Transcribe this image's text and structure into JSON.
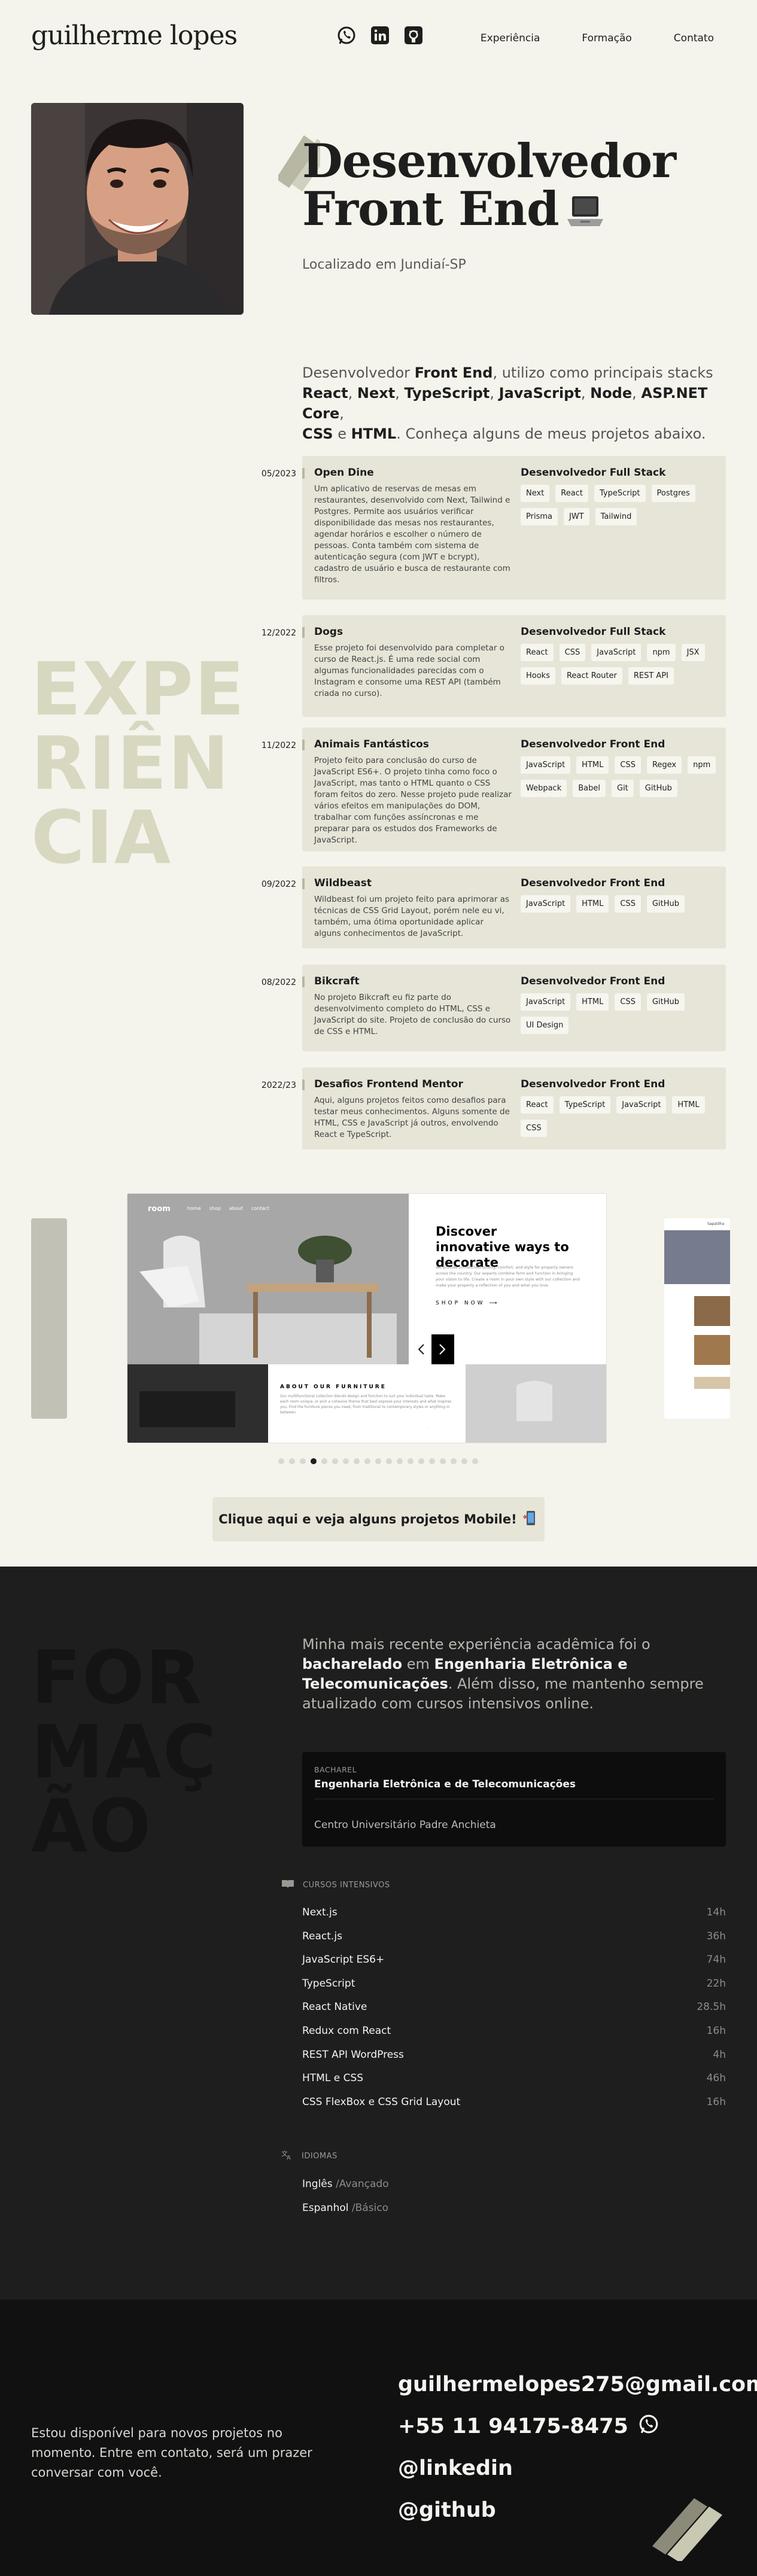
{
  "header": {
    "logo": "guilherme lopes",
    "nav": [
      "Experiência",
      "Formação",
      "Contato"
    ]
  },
  "hero": {
    "title_line1": "Desenvolvedor",
    "title_line2": "Front End",
    "location": "Localizado em Jundiaí-SP",
    "intro_pre": "Desenvolvedor ",
    "intro_b1": "Front End",
    "intro_mid": ", utilizo como principais stacks ",
    "intro_b2": "React",
    "intro_b3": "Next",
    "intro_b4": "TypeScript",
    "intro_b5": "JavaScript",
    "intro_b6": "Node",
    "intro_b7": "ASP.NET Core",
    "intro_b8": "CSS",
    "intro_e": " e ",
    "intro_b9": "HTML",
    "intro_post": ". Conheça alguns de meus projetos abaixo.",
    "comma": ", "
  },
  "experience": {
    "big_word": [
      "EXPE",
      "RIÊN",
      "CIA"
    ],
    "items": [
      {
        "date": "05/2023",
        "name": "Open Dine",
        "desc": "Um aplicativo de reservas de mesas em restaurantes, desenvolvido com Next, Tailwind e Postgres. Permite aos usuários verificar disponibilidade das mesas nos restaurantes, agendar horários e escolher o número de pessoas. Conta também com sistema de autenticação segura (com JWT e bcrypt), cadastro de usuário e busca de restaurante com filtros.",
        "role": "Desenvolvedor Full Stack",
        "tags": [
          "Next",
          "React",
          "TypeScript",
          "Postgres",
          "Prisma",
          "JWT",
          "Tailwind"
        ]
      },
      {
        "date": "12/2022",
        "name": "Dogs",
        "desc": "Esse projeto foi desenvolvido para completar o curso de React.js. É uma rede social com algumas funcionalidades parecidas com o Instagram e consome uma REST API (também criada no curso).",
        "role": "Desenvolvedor Full Stack",
        "tags": [
          "React",
          "CSS",
          "JavaScript",
          "npm",
          "JSX",
          "Hooks",
          "React Router",
          "REST API"
        ]
      },
      {
        "date": "11/2022",
        "name": "Animais Fantásticos",
        "desc": "Projeto feito para conclusão do curso de JavaScript ES6+. O projeto tinha como foco o JavaScript, mas tanto o HTML quanto o CSS foram feitos do zero. Nesse projeto pude realizar vários efeitos em manipulações do DOM, trabalhar com funções assíncronas e me preparar para os estudos dos Frameworks de JavaScript.",
        "role": "Desenvolvedor Front End",
        "tags": [
          "JavaScript",
          "HTML",
          "CSS",
          "Regex",
          "npm",
          "Webpack",
          "Babel",
          "Git",
          "GitHub"
        ]
      },
      {
        "date": "09/2022",
        "name": "Wildbeast",
        "desc": "Wildbeast foi um projeto feito para aprimorar as técnicas de CSS Grid Layout, porém nele eu vi, também, uma ótima oportunidade aplicar alguns conhecimentos de JavaScript.",
        "role": "Desenvolvedor Front End",
        "tags": [
          "JavaScript",
          "HTML",
          "CSS",
          "GitHub"
        ]
      },
      {
        "date": "08/2022",
        "name": "Bikcraft",
        "desc": "No projeto Bikcraft eu fiz parte do desenvolvimento completo do HTML, CSS e JavaScript do site. Projeto de conclusão do curso de CSS e HTML.",
        "role": "Desenvolvedor Front End",
        "tags": [
          "JavaScript",
          "HTML",
          "CSS",
          "GitHub",
          "UI Design"
        ]
      },
      {
        "date": "2022/23",
        "name": "Desafios Frontend Mentor",
        "desc": "Aqui, alguns projetos feitos como desafios para testar meus conhecimentos. Alguns somente de HTML, CSS e JavaScript já outros, envolvendo React e TypeScript.",
        "role": "Desenvolvedor Front End",
        "tags": [
          "React",
          "TypeScript",
          "JavaScript",
          "HTML",
          "CSS"
        ]
      }
    ]
  },
  "carousel": {
    "brand": "room",
    "menu": [
      "home",
      "shop",
      "about",
      "contact"
    ],
    "headline": "Discover innovative ways to decorate",
    "body": "We provide unmatched quality, comfort, and style for property owners across the country. Our experts combine form and function in bringing your vision to life. Create a room in your own style with our collection and make your property a reflection of you and what you love.",
    "cta": "SHOP NOW",
    "about_title": "ABOUT OUR FURNITURE",
    "about_body": "Our multifunctional collection blends design and function to suit your individual taste. Make each room unique, or pick a cohesive theme that best express your interests and what inspires you. Find the furniture pieces you need, from traditional to contemporary styles or anything in between.",
    "side_label": "Sapatilha",
    "dots": 19,
    "active_dot": 3,
    "mobile_button": "Clique aqui e veja alguns projetos Mobile!"
  },
  "formation": {
    "big_word": [
      "FOR",
      "MAÇ",
      "ÃO"
    ],
    "intro_pre": "Minha mais recente experiência acadêmica foi o ",
    "intro_b1": "bacharelado",
    "intro_mid": " em ",
    "intro_b2": "Engenharia Eletrônica e Telecomunicações",
    "intro_post": ". Além disso, me mantenho sempre atualizado com cursos intensivos online.",
    "degree_label": "BACHAREL",
    "degree_course": "Engenharia Eletrônica e de Telecomunicações",
    "degree_university": "Centro Universitário Padre Anchieta",
    "courses_heading": "CURSOS INTENSIVOS",
    "courses": [
      {
        "name": "Next.js",
        "hours": "14h"
      },
      {
        "name": "React.js",
        "hours": "36h"
      },
      {
        "name": "JavaScript ES6+",
        "hours": "74h"
      },
      {
        "name": "TypeScript",
        "hours": "22h"
      },
      {
        "name": "React Native",
        "hours": "28.5h"
      },
      {
        "name": "Redux com React",
        "hours": "16h"
      },
      {
        "name": "REST API WordPress",
        "hours": "4h"
      },
      {
        "name": "HTML e CSS",
        "hours": "46h"
      },
      {
        "name": "CSS FlexBox e CSS Grid Layout",
        "hours": "16h"
      }
    ],
    "languages_heading": "IDIOMAS",
    "languages": [
      {
        "name": "Inglês",
        "level": "/Avançado"
      },
      {
        "name": "Espanhol",
        "level": "/Básico"
      }
    ]
  },
  "contact": {
    "text": "Estou disponível para novos projetos no momento. Entre em contato, será um prazer conversar com você.",
    "email": "guilhermelopes275@gmail.com",
    "phone": "+55 11 94175-8475",
    "linkedin": "@linkedin",
    "github": "@github"
  },
  "colors": {
    "background": "#f4f4ec",
    "card": "#e6e5d8",
    "dark": "#1e1e1e",
    "big_word_light": "#d8d7c0"
  }
}
